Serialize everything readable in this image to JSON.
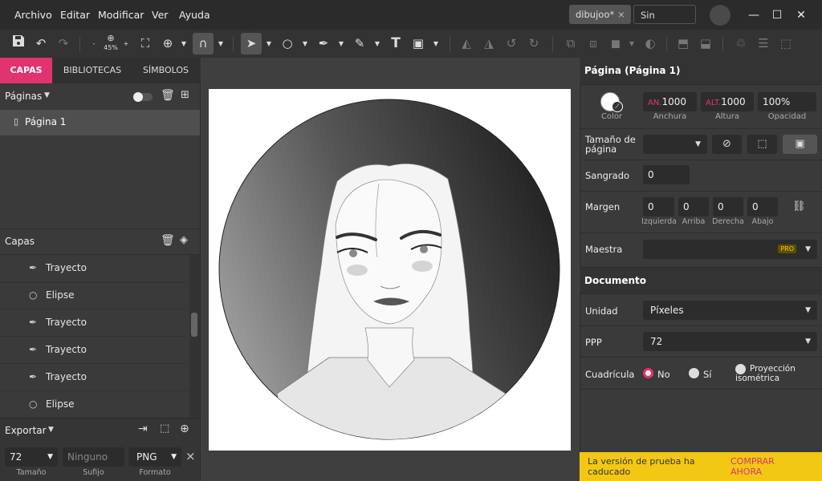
{
  "menu": [
    "Archivo",
    "Editar",
    "Modificar",
    "Ver",
    "Ayuda"
  ],
  "tabs": [
    {
      "label": "dibujoo*",
      "close": "×"
    },
    {
      "label": "Sin título*",
      "close": "×"
    }
  ],
  "window_controls": {
    "minimize": "—",
    "maximize": "☐",
    "close": "✕"
  },
  "toolbar": {
    "zoom_level": "45%",
    "zoom_out": "-",
    "zoom_in": "+"
  },
  "left_tabs": [
    "CAPAS",
    "BIBLIOTECAS",
    "SÍMBOLOS"
  ],
  "pages_header": "Páginas",
  "pages": [
    {
      "label": "Página 1"
    }
  ],
  "layers_header": "Capas",
  "layers": [
    {
      "label": "Trayecto",
      "icon": "pen-icon"
    },
    {
      "label": "Elipse",
      "icon": "circle-icon"
    },
    {
      "label": "Trayecto",
      "icon": "pen-icon"
    },
    {
      "label": "Trayecto",
      "icon": "pen-icon"
    },
    {
      "label": "Trayecto",
      "icon": "pen-icon"
    },
    {
      "label": "Elipse",
      "icon": "circle-icon"
    }
  ],
  "export": {
    "header": "Exportar",
    "size_value": "72",
    "size_label": "Tamaño",
    "suffix_placeholder": "Ninguno",
    "suffix_label": "Sufijo",
    "format_value": "PNG",
    "format_label": "Formato",
    "close": "×"
  },
  "properties": {
    "title": "Página (Página 1)",
    "color_label": "Color",
    "width_prefix": "AN.",
    "width_value": "1000",
    "width_label": "Anchura",
    "height_prefix": "ALT.",
    "height_value": "1000",
    "height_label": "Altura",
    "opacity_value": "100%",
    "opacity_label": "Opacidad",
    "page_size_label": "Tamaño de página",
    "bleed_label": "Sangrado",
    "bleed_value": "0",
    "margin_label": "Margen",
    "margins": [
      {
        "value": "0",
        "label": "Izquierda"
      },
      {
        "value": "0",
        "label": "Arriba"
      },
      {
        "value": "0",
        "label": "Derecha"
      },
      {
        "value": "0",
        "label": "Abajo"
      }
    ],
    "master_label": "Maestra",
    "pro_badge": "PRO"
  },
  "document": {
    "title": "Documento",
    "unit_label": "Unidad",
    "unit_value": "Píxeles",
    "ppp_label": "PPP",
    "ppp_value": "72",
    "grid_label": "Cuadrícula",
    "grid_options": [
      "No",
      "Sí",
      "Proyección isométrica"
    ],
    "grid_selected": "No"
  },
  "trial": {
    "message": "La versión de prueba ha caducado",
    "cta": "COMPRAR AHORA"
  },
  "colors": {
    "accent": "#e0336f",
    "trial_bg": "#f3c814",
    "cta": "#e0336f"
  }
}
